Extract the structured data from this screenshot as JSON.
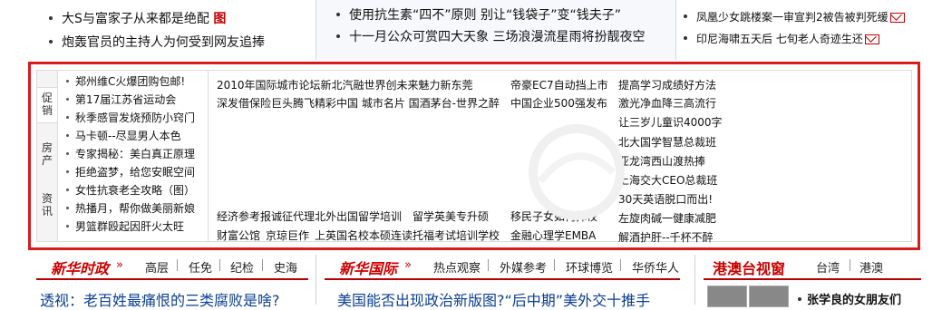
{
  "top_news": {
    "left": [
      "大S与富家子从来都是绝配",
      "炮轰官员的主持人为何受到网友追捧"
    ],
    "left_tag": "图",
    "mid": [
      "使用抗生素“四不”原则 别让“钱袋子”变“钱夫子”",
      "十一月公众可赏四大天象 三场浪漫流星雨将扮靓夜空"
    ],
    "right": [
      "凤凰少女跳楼案一审宣判2被告被判死缓",
      "印尼海啸五天后 七旬老人奇迹生还"
    ]
  },
  "promo": {
    "tabs": [
      "促销",
      "房产",
      "资讯"
    ],
    "list": [
      "郑州维C火爆团购包邮!",
      "第17届江苏省运动会",
      "秋季感冒发烧预防小窍门",
      "马卡顿--尽显男人本色",
      "专家揭秘：美白真正原理",
      "拒绝盗梦，给您安眠空间",
      "女性抗衰老全攻略（图）",
      "热播月，帮你做美丽新娘",
      "男篮群殴起因肝火太旺"
    ],
    "links_col1": [
      "2010年国际城市论坛新北汽融世界创未来魅力新东莞",
      "深发借保险巨头腾飞精彩中国 城市名片 国酒茅台-世界之醉"
    ],
    "links_col2": [
      "帝豪EC7自动挡上市",
      "中国企业500强发布"
    ],
    "links_col3": [
      "提高学习成绩好方法",
      "激光净血降三高流行",
      "让三岁儿童识4000字",
      "北大国学智慧总裁班",
      "亚龙湾西山渡热捧",
      "上海交大CEO总裁班",
      "30天英语脱口而出!",
      "左旋肉碱一健康减肥",
      "解酒护肝--千杯不醉"
    ],
    "bottom_row1": [
      "经济参考报诚征代理北外出国留学培训",
      "留学英美专升硕",
      "移民子女如何择校"
    ],
    "bottom_row2": [
      "财富公馆",
      "京琼巨作",
      "上英国名校本硕连读托福考试培训学校",
      "金融心理学EMBA"
    ]
  },
  "sections": {
    "xinhua_shizheng": {
      "title": "新华时政",
      "links": [
        "高层",
        "任免",
        "纪检",
        "史海"
      ]
    },
    "xinhua_guoji": {
      "title": "新华国际",
      "links": [
        "热点观察",
        "外媒参考",
        "环球博览",
        "华侨华人"
      ]
    },
    "gangao": {
      "title": "港澳台视窗",
      "links": [
        "台湾",
        "港澳"
      ]
    }
  },
  "bottom_headlines": [
    "透视：老百姓最痛恨的三类腐败是啥?",
    "美国能否出现政治新版图?“后中期”美外交十推手",
    "张学良的女朋友们"
  ]
}
